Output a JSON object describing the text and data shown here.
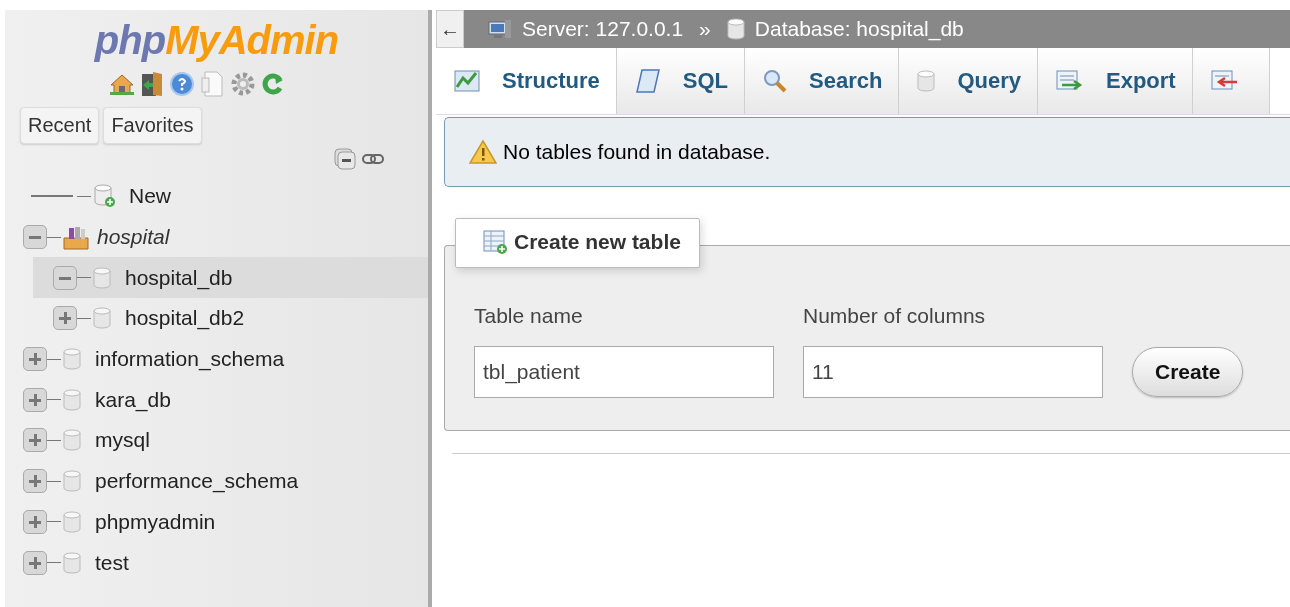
{
  "logo": {
    "prefix": "php",
    "suffix": "MyAdmin"
  },
  "sidebar_buttons": [
    {
      "label": "Recent"
    },
    {
      "label": "Favorites"
    }
  ],
  "tree": [
    {
      "kind": "new",
      "label": "New"
    },
    {
      "kind": "group",
      "label": "hospital",
      "expanded": true,
      "children": [
        {
          "kind": "database",
          "label": "hospital_db",
          "expanded": true,
          "selected": true
        },
        {
          "kind": "database",
          "label": "hospital_db2",
          "expanded": false,
          "selected": false
        }
      ]
    },
    {
      "kind": "database",
      "label": "information_schema",
      "expanded": false,
      "selected": false
    },
    {
      "kind": "database",
      "label": "kara_db",
      "expanded": false,
      "selected": false
    },
    {
      "kind": "database",
      "label": "mysql",
      "expanded": false,
      "selected": false
    },
    {
      "kind": "database",
      "label": "performance_schema",
      "expanded": false,
      "selected": false
    },
    {
      "kind": "database",
      "label": "phpmyadmin",
      "expanded": false,
      "selected": false
    },
    {
      "kind": "database",
      "label": "test",
      "expanded": false,
      "selected": false
    }
  ],
  "breadcrumb": {
    "back": "←",
    "server": "Server: 127.0.0.1",
    "separator": "»",
    "database": "Database: hospital_db"
  },
  "tabs": [
    {
      "kind": "structure",
      "label": "Structure",
      "selected": true
    },
    {
      "kind": "sql",
      "label": "SQL",
      "selected": false
    },
    {
      "kind": "search",
      "label": "Search",
      "selected": false
    },
    {
      "kind": "query",
      "label": "Query",
      "selected": false
    },
    {
      "kind": "export",
      "label": "Export",
      "selected": false
    },
    {
      "kind": "import",
      "selected": false
    }
  ],
  "notice": "No tables found in database.",
  "create_table": {
    "legend": "Create new table",
    "table_name_label": "Table name",
    "table_name": "tbl_patient",
    "columns_label": "Number of columns",
    "columns": "11",
    "button": "Create"
  }
}
